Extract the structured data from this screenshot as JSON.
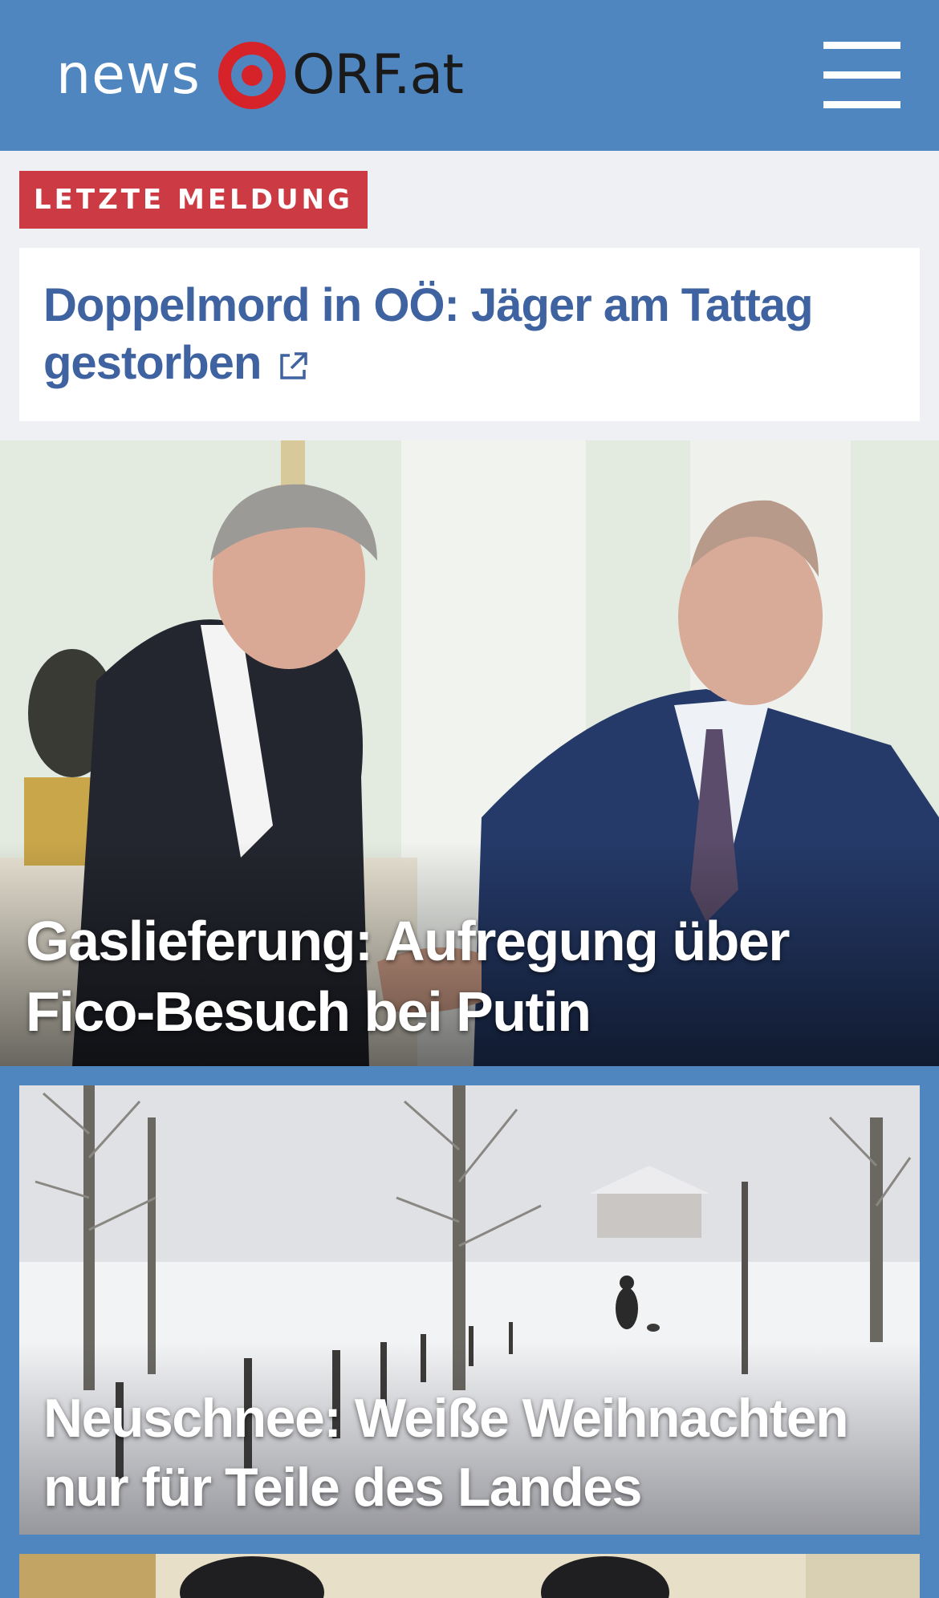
{
  "header": {
    "logo_news": "news",
    "logo_orf": "ORF.at",
    "menu_icon": "hamburger-menu-icon",
    "background_color": "#4f86c0",
    "accent_color": "#d6232a"
  },
  "breaking": {
    "badge": "LETZTE MELDUNG",
    "title": "Doppelmord in OÖ: Jäger am Tattag gestorben",
    "link_icon": "external-link-icon",
    "badge_color": "#cc3a43",
    "title_color": "#3f63a0"
  },
  "stories": [
    {
      "title": "Gaslieferung: Aufregung über Fico-Besuch bei Putin",
      "image": "photo of two men shaking hands"
    },
    {
      "title": "Neuschnee: Weiße Weihnachten nur für Teile des Landes",
      "image": "photo of snowy park with walker and dog"
    },
    {
      "title": "",
      "image": "partially visible photo"
    }
  ]
}
